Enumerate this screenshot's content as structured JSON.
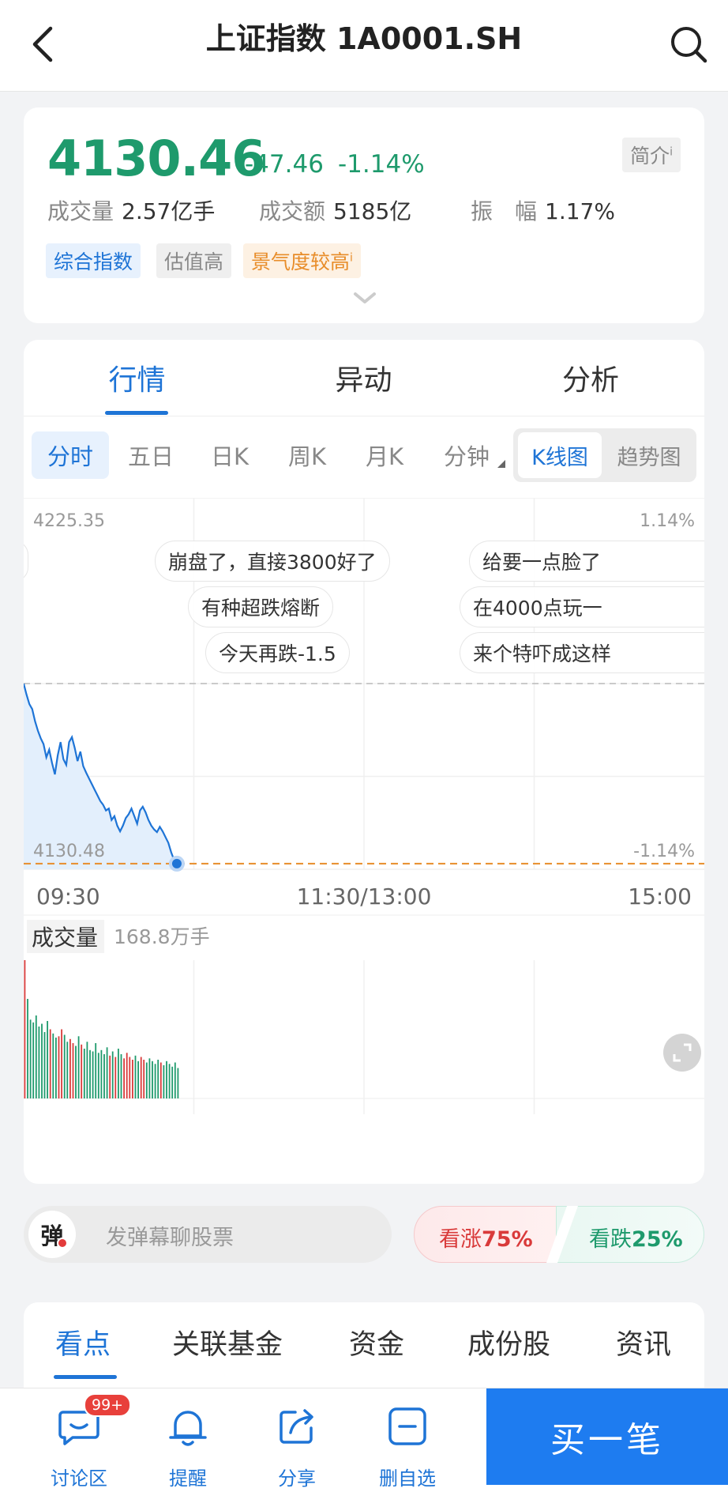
{
  "header": {
    "title": "上证指数 1A0001.SH"
  },
  "quote": {
    "price": "4130.46",
    "change_abs": "-47.46",
    "change_pct": "-1.14%",
    "intro": "简介",
    "volume_label": "成交量",
    "volume": "2.57亿手",
    "turnover_label": "成交额",
    "turnover": "5185亿",
    "amplitude_label": "振　幅",
    "amplitude": "1.17%",
    "tags": [
      "综合指数",
      "估值高",
      "景气度较高"
    ],
    "colors": {
      "down": "#1e9a6c",
      "up": "#d93a3a",
      "accent": "#1e74d6",
      "avg_line": "#e88d2a"
    }
  },
  "main_tabs": [
    "行情",
    "异动",
    "分析"
  ],
  "periods": [
    "分时",
    "五日",
    "日K",
    "周K",
    "月K",
    "分钟"
  ],
  "chart_mode": {
    "kline": "K线图",
    "trend": "趋势图"
  },
  "danmaku": [
    "崩盘了，直接3800好了",
    "有种超跌熔断",
    "今天再跌-1.5",
    "给要一点脸了",
    "在4000点玩一",
    "来个特吓成这样"
  ],
  "volume_panel": {
    "label": "成交量",
    "value": "168.8万手"
  },
  "chart_data": {
    "type": "line",
    "title": "",
    "y_top_label": "4225.35",
    "y_bottom_label": "4130.48",
    "pct_top_label": "1.14%",
    "pct_bottom_label": "-1.14%",
    "ylim": [
      4130.48,
      4225.35
    ],
    "prev_close": 4177.92,
    "x_ticks": [
      "09:30",
      "11:30/13:00",
      "15:00"
    ],
    "total_minutes": 240,
    "series": [
      {
        "x": [
          0,
          1,
          2,
          3,
          4,
          5,
          6,
          7,
          8,
          9,
          10,
          11,
          12,
          13,
          14,
          15,
          16,
          17,
          18,
          19,
          20,
          21,
          22,
          23,
          24,
          25,
          26,
          27,
          28,
          29,
          30,
          31,
          32,
          33,
          34,
          35,
          36,
          37,
          38,
          39,
          40,
          41,
          42,
          43,
          44,
          45,
          46,
          47,
          48,
          49,
          50,
          51,
          52,
          53,
          54
        ],
        "values": [
          4177.9,
          4175.0,
          4172.5,
          4171.2,
          4168.0,
          4165.5,
          4163.5,
          4162.0,
          4158.5,
          4160.5,
          4157.0,
          4154.0,
          4159.0,
          4162.5,
          4158.0,
          4156.5,
          4162.5,
          4163.8,
          4161.0,
          4157.5,
          4160.0,
          4156.2,
          4154.5,
          4153.0,
          4151.5,
          4150.0,
          4148.5,
          4147.0,
          4146.0,
          4144.5,
          4145.0,
          4142.0,
          4143.0,
          4140.5,
          4139.0,
          4140.5,
          4142.5,
          4143.5,
          4145.0,
          4143.0,
          4141.0,
          4144.5,
          4145.5,
          4144.0,
          4142.0,
          4140.5,
          4139.5,
          4138.8,
          4140.2,
          4139.0,
          4137.5,
          4136.0,
          4133.5,
          4131.5,
          4130.5
        ]
      }
    ],
    "volume_values": [
      1.0,
      0.72,
      0.57,
      0.55,
      0.6,
      0.52,
      0.54,
      0.48,
      0.56,
      0.5,
      0.47,
      0.44,
      0.45,
      0.5,
      0.46,
      0.41,
      0.43,
      0.4,
      0.38,
      0.45,
      0.39,
      0.36,
      0.41,
      0.35,
      0.34,
      0.4,
      0.33,
      0.35,
      0.32,
      0.37,
      0.31,
      0.34,
      0.3,
      0.36,
      0.32,
      0.29,
      0.33,
      0.3,
      0.28,
      0.31,
      0.27,
      0.3,
      0.28,
      0.26,
      0.29,
      0.27,
      0.25,
      0.28,
      0.26,
      0.24,
      0.27,
      0.25,
      0.23,
      0.26,
      0.22
    ]
  },
  "sentiment": {
    "bull_label": "看涨",
    "bull_pct": "75%",
    "bear_label": "看跌",
    "bear_pct": "25%"
  },
  "danmaku_input": {
    "badge": "弹",
    "placeholder": "发弹幕聊股票"
  },
  "content_tabs": [
    "看点",
    "关联基金",
    "资金",
    "成份股",
    "资讯"
  ],
  "bottom_bar": {
    "discuss": "讨论区",
    "discuss_badge": "99+",
    "alert": "提醒",
    "share": "分享",
    "remove_watch": "删自选",
    "buy": "买一笔"
  }
}
